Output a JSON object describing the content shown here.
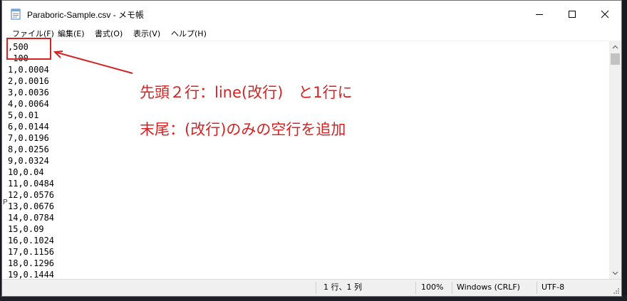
{
  "window": {
    "title": "Paraboric-Sample.csv - メモ帳"
  },
  "menu": [
    {
      "label": "ファイル(F)"
    },
    {
      "label": "編集(E)"
    },
    {
      "label": "書式(O)"
    },
    {
      "label": "表示(V)"
    },
    {
      "label": "ヘルプ(H)"
    }
  ],
  "editor": {
    "lines": [
      ",500",
      " 100",
      "1,0.0004",
      "2,0.0016",
      "3,0.0036",
      "4,0.0064",
      "5,0.01",
      "6,0.0144",
      "7,0.0196",
      "8,0.0256",
      "9,0.0324",
      "10,0.04",
      "11,0.0484",
      "12,0.0576",
      "13,0.0676",
      "14,0.0784",
      "15,0.09",
      "16,0.1024",
      "17,0.1156",
      "18,0.1296",
      "19,0.1444"
    ]
  },
  "status": {
    "position": "1 行、1 列",
    "zoom": "100%",
    "line_ending": "Windows (CRLF)",
    "encoding": "UTF-8"
  },
  "annotation": {
    "line1": "先頭２行：line(改行)　と1行に",
    "line2": "末尾：(改行)のみの空行を追加",
    "color": "#d42323"
  },
  "edge_char": "P"
}
